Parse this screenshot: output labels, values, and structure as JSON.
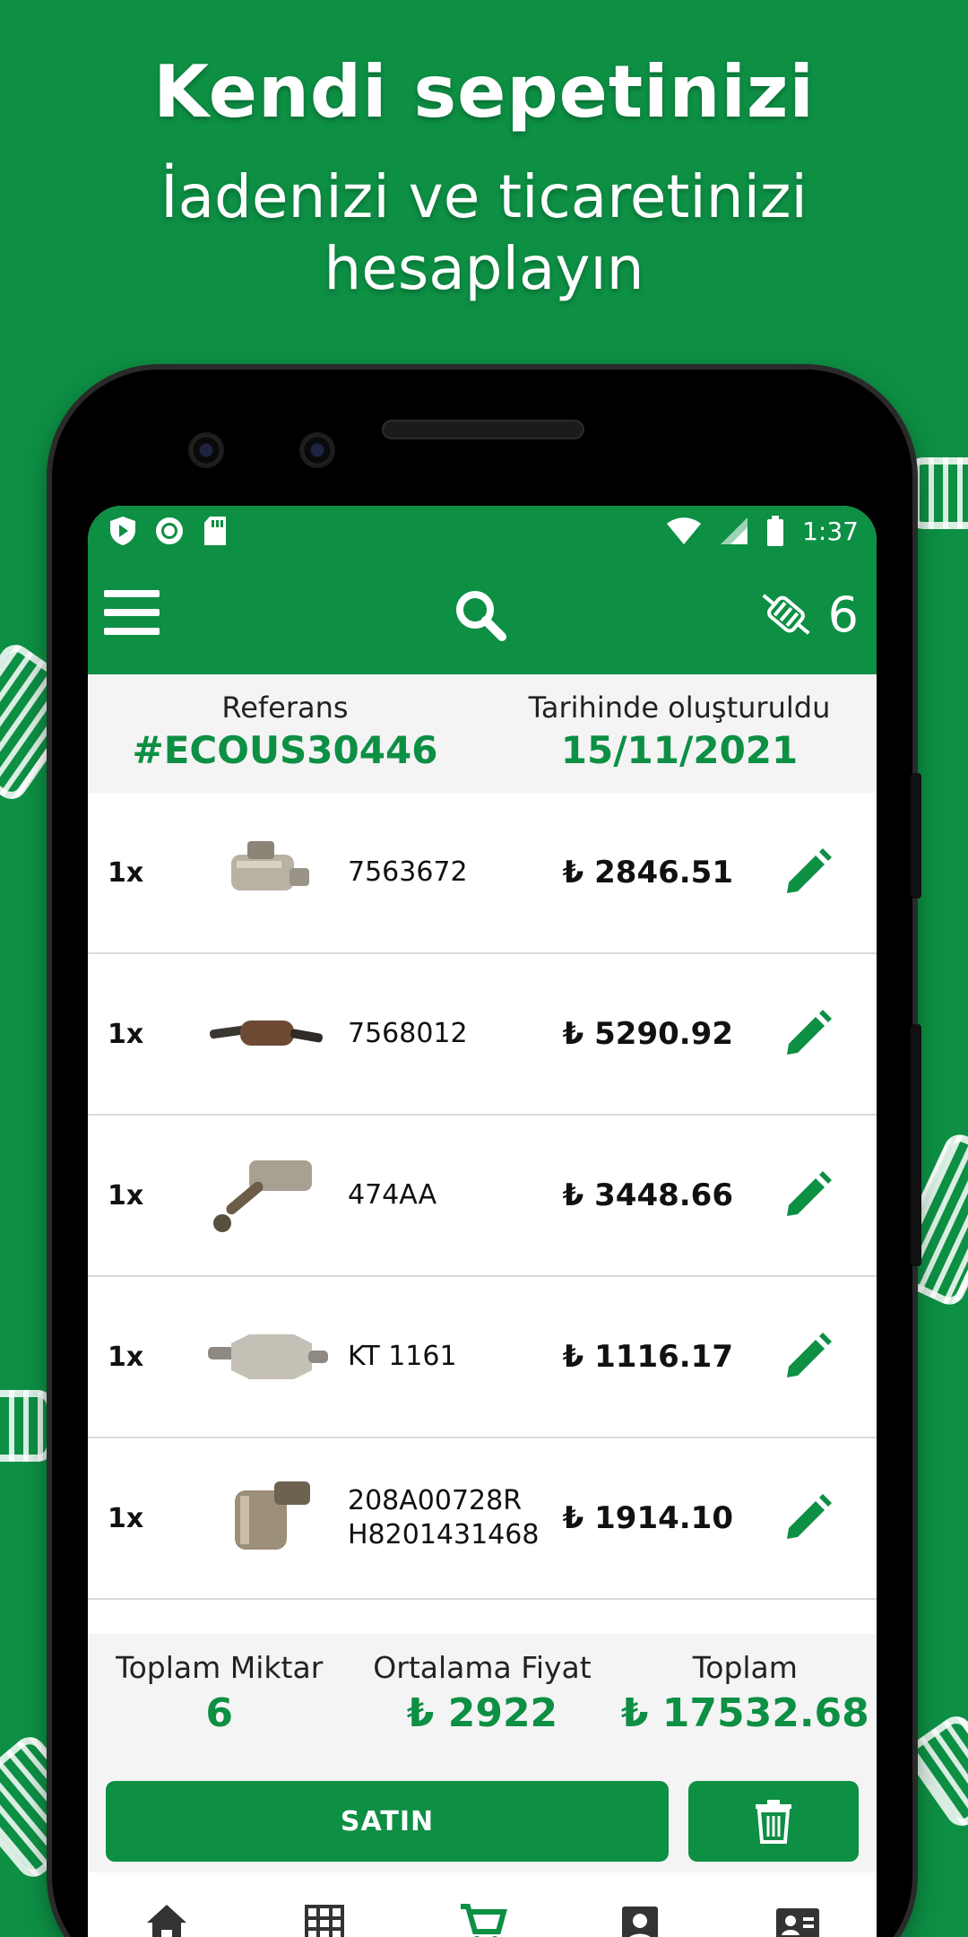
{
  "promo": {
    "headline": "Kendi sepetinizi",
    "subline_1": "İadenizi ve ticaretinizi",
    "subline_2": "hesaplayın"
  },
  "status_bar": {
    "time": "1:37"
  },
  "app_bar": {
    "cart_count": "6"
  },
  "reference": {
    "ref_label": "Referans",
    "ref_value": "#ECOUS30446",
    "date_label": "Tarihinde oluşturuldu",
    "date_value": "15/11/2021"
  },
  "items": [
    {
      "qty": "1x",
      "ref_line1": "7563672",
      "ref_line2": "",
      "price": "₺ 2846.51"
    },
    {
      "qty": "1x",
      "ref_line1": "7568012",
      "ref_line2": "",
      "price": "₺ 5290.92"
    },
    {
      "qty": "1x",
      "ref_line1": "474AA",
      "ref_line2": "",
      "price": "₺ 3448.66"
    },
    {
      "qty": "1x",
      "ref_line1": "KT 1161",
      "ref_line2": "",
      "price": "₺ 1116.17"
    },
    {
      "qty": "1x",
      "ref_line1": "208A00728R",
      "ref_line2": "H8201431468",
      "price": "₺ 1914.10"
    }
  ],
  "summary": {
    "total_qty_label": "Toplam Miktar",
    "total_qty_value": "6",
    "avg_price_label": "Ortalama Fiyat",
    "avg_price_value": "₺ 2922",
    "total_label": "Toplam",
    "total_value": "₺ 17532.68"
  },
  "actions": {
    "buy_label": "SATIN"
  },
  "colors": {
    "brand": "#0d8f44",
    "band": "#f4f4f4"
  },
  "icons": [
    "menu-icon",
    "search-icon",
    "catalytic-converter-icon",
    "edit-icon",
    "trash-icon",
    "home-icon",
    "grid-icon",
    "cart-icon",
    "account-icon",
    "contact-icon"
  ]
}
